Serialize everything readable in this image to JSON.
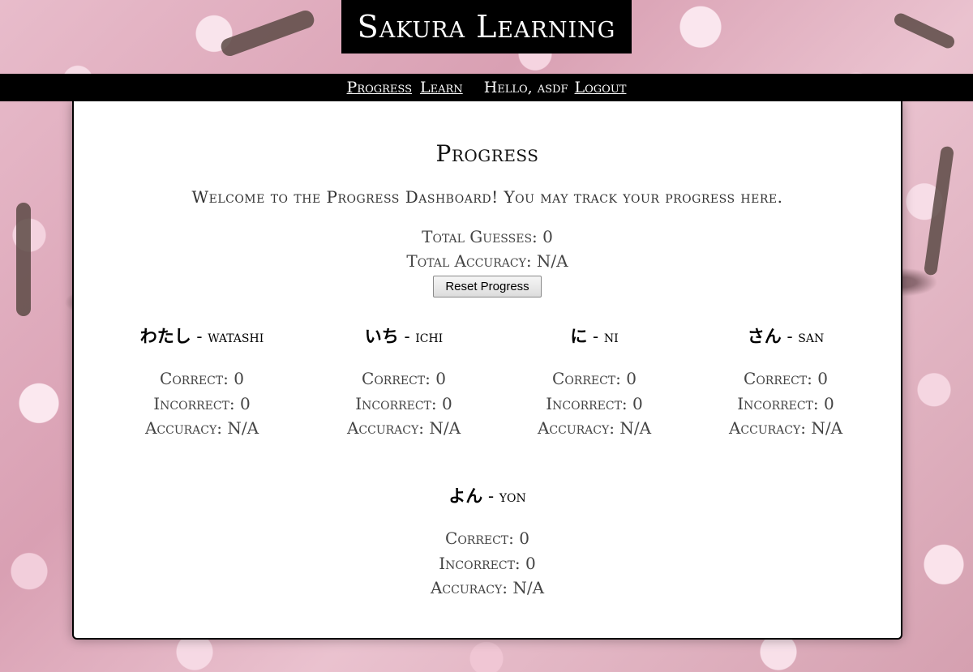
{
  "app": {
    "title": "Sakura Learning"
  },
  "nav": {
    "progress_label": "Progress",
    "learn_label": "Learn",
    "greeting": "Hello, asdf",
    "logout_label": "Logout"
  },
  "page": {
    "title": "Progress",
    "welcome": "Welcome to the Progress Dashboard! You may track your progress here.",
    "total_guesses": "Total Guesses: 0",
    "total_accuracy": "Total Accuracy: N/A",
    "reset_label": "Reset Progress"
  },
  "cards": [
    {
      "kana": "わたし",
      "separator": " - ",
      "romaji": "watashi",
      "correct": "Correct: 0",
      "incorrect": "Incorrect: 0",
      "accuracy": "Accuracy: N/A"
    },
    {
      "kana": "いち",
      "separator": " - ",
      "romaji": "ichi",
      "correct": "Correct: 0",
      "incorrect": "Incorrect: 0",
      "accuracy": "Accuracy: N/A"
    },
    {
      "kana": "に",
      "separator": " - ",
      "romaji": "ni",
      "correct": "Correct: 0",
      "incorrect": "Incorrect: 0",
      "accuracy": "Accuracy: N/A"
    },
    {
      "kana": "さん",
      "separator": " - ",
      "romaji": "san",
      "correct": "Correct: 0",
      "incorrect": "Incorrect: 0",
      "accuracy": "Accuracy: N/A"
    },
    {
      "kana": "よん",
      "separator": " - ",
      "romaji": "yon",
      "correct": "Correct: 0",
      "incorrect": "Incorrect: 0",
      "accuracy": "Accuracy: N/A"
    }
  ]
}
